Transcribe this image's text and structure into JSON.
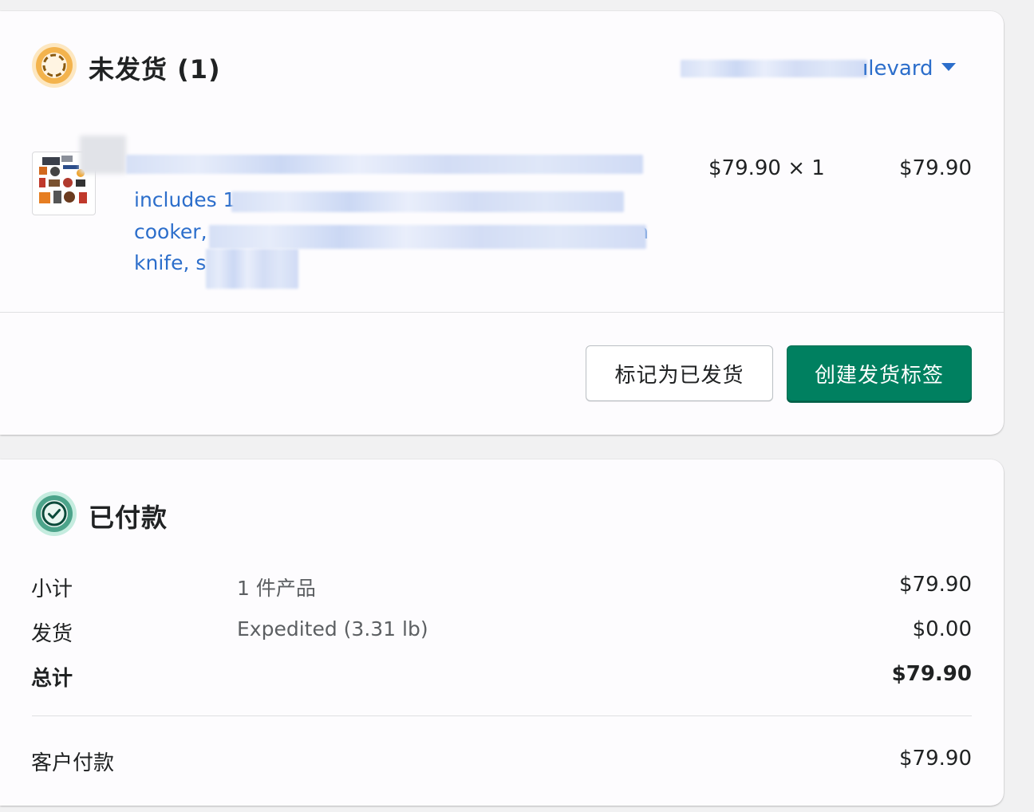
{
  "colors": {
    "primary_green": "#008060",
    "link_blue": "#2c6ecb",
    "unfulfilled_ring": "#f3b34d",
    "paid_ring": "#4ca38a"
  },
  "unfulfilled": {
    "icon": "progress-circle-icon",
    "title": "未发货 (1)",
    "location_partial": "ılevard",
    "location_icon": "chevron-down-icon",
    "item": {
      "desc_lines": [
        "includes 1",
        "cooker,",
        "knife, s"
      ],
      "desc_trailing": "ın",
      "unit_price": "$79.90 × 1",
      "total": "$79.90"
    },
    "buttons": {
      "mark_fulfilled": "标记为已发货",
      "create_label": "创建发货标签"
    }
  },
  "paid": {
    "icon": "check-circle-icon",
    "title": "已付款",
    "rows": [
      {
        "label": "小计",
        "detail": "1 件产品",
        "amount": "$79.90"
      },
      {
        "label": "发货",
        "detail": "Expedited (3.31 lb)",
        "amount": "$0.00"
      },
      {
        "label": "总计",
        "detail": "",
        "amount": "$79.90"
      }
    ],
    "customer_paid": {
      "label": "客户付款",
      "amount": "$79.90"
    }
  }
}
